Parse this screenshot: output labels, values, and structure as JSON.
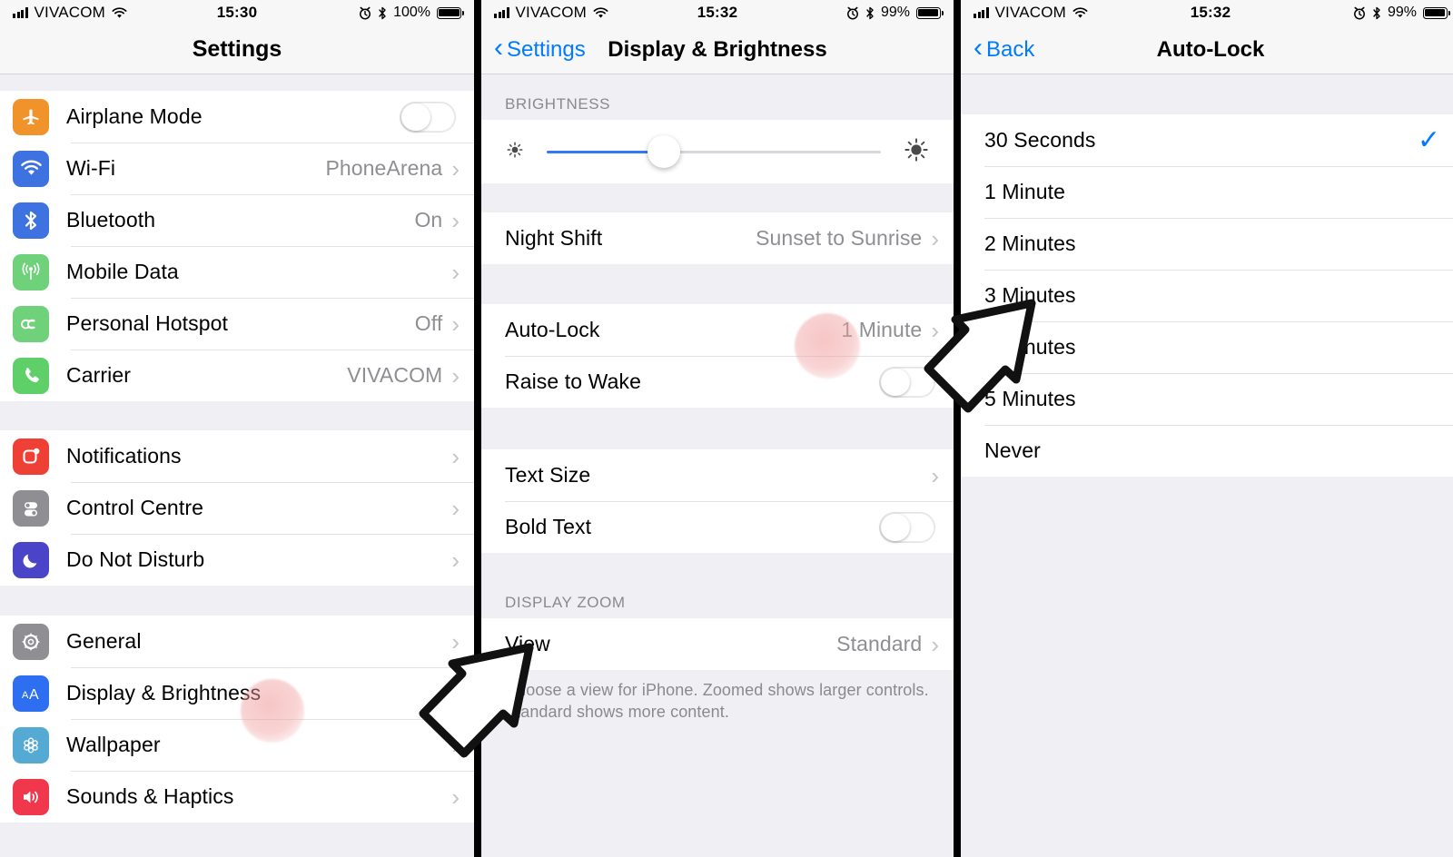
{
  "panels": [
    {
      "id": "settings",
      "status": {
        "carrier": "VIVACOM",
        "time": "15:30",
        "battery_pct": "100%"
      },
      "nav": {
        "title": "Settings",
        "back": ""
      },
      "groups": [
        {
          "rows": [
            {
              "label": "Airplane Mode",
              "icon": "airplane-icon",
              "color": "#f0932b",
              "control": "toggle-off"
            },
            {
              "label": "Wi-Fi",
              "icon": "wifi-icon",
              "color": "#3e72e0",
              "value": "PhoneArena",
              "control": "chevron"
            },
            {
              "label": "Bluetooth",
              "icon": "bluetooth-icon",
              "color": "#3e72e0",
              "value": "On",
              "control": "chevron"
            },
            {
              "label": "Mobile Data",
              "icon": "cellular-icon",
              "color": "#6fd27a",
              "value": "",
              "control": "chevron"
            },
            {
              "label": "Personal Hotspot",
              "icon": "hotspot-icon",
              "color": "#6fd27a",
              "value": "Off",
              "control": "chevron"
            },
            {
              "label": "Carrier",
              "icon": "phone-icon",
              "color": "#5fd068",
              "value": "VIVACOM",
              "control": "chevron"
            }
          ]
        },
        {
          "rows": [
            {
              "label": "Notifications",
              "icon": "notifications-icon",
              "color": "#ef4036",
              "value": "",
              "control": "chevron"
            },
            {
              "label": "Control Centre",
              "icon": "control-centre-icon",
              "color": "#8e8e93",
              "value": "",
              "control": "chevron"
            },
            {
              "label": "Do Not Disturb",
              "icon": "moon-icon",
              "color": "#4a44c9",
              "value": "",
              "control": "chevron"
            }
          ]
        },
        {
          "rows": [
            {
              "label": "General",
              "icon": "gear-icon",
              "color": "#8e8e93",
              "value": "",
              "control": "chevron"
            },
            {
              "label": "Display & Brightness",
              "icon": "text-size-icon",
              "color": "#2e6ff2",
              "value": "",
              "control": "chevron"
            },
            {
              "label": "Wallpaper",
              "icon": "wallpaper-icon",
              "color": "#55aad4",
              "value": "",
              "control": "chevron"
            },
            {
              "label": "Sounds & Haptics",
              "icon": "sound-icon",
              "color": "#f1374c",
              "value": "",
              "control": "chevron"
            }
          ]
        }
      ]
    },
    {
      "id": "display-brightness",
      "status": {
        "carrier": "VIVACOM",
        "time": "15:32",
        "battery_pct": "99%"
      },
      "nav": {
        "title": "Display & Brightness",
        "back": "Settings"
      },
      "section_brightness": "BRIGHTNESS",
      "brightness": {
        "value_percent": 35,
        "low_icon": "sun-low-icon",
        "high_icon": "sun-high-icon"
      },
      "rows_night": [
        {
          "label": "Night Shift",
          "value": "Sunset to Sunrise",
          "control": "chevron"
        }
      ],
      "rows_lock": [
        {
          "label": "Auto-Lock",
          "value": "1 Minute",
          "control": "chevron"
        },
        {
          "label": "Raise to Wake",
          "value": "",
          "control": "toggle-off"
        }
      ],
      "rows_text": [
        {
          "label": "Text Size",
          "value": "",
          "control": "chevron"
        },
        {
          "label": "Bold Text",
          "value": "",
          "control": "toggle-off"
        }
      ],
      "section_zoom": "DISPLAY ZOOM",
      "rows_zoom": [
        {
          "label": "View",
          "value": "Standard",
          "control": "chevron"
        }
      ],
      "footnote": "Choose a view for iPhone. Zoomed shows larger controls. Standard shows more content."
    },
    {
      "id": "auto-lock",
      "status": {
        "carrier": "VIVACOM",
        "time": "15:32",
        "battery_pct": "99%"
      },
      "nav": {
        "title": "Auto-Lock",
        "back": "Back"
      },
      "options": [
        {
          "label": "30 Seconds",
          "selected": true
        },
        {
          "label": "1 Minute",
          "selected": false
        },
        {
          "label": "2 Minutes",
          "selected": false
        },
        {
          "label": "3 Minutes",
          "selected": false
        },
        {
          "label": "4 Minutes",
          "selected": false
        },
        {
          "label": "5 Minutes",
          "selected": false
        },
        {
          "label": "Never",
          "selected": false
        }
      ]
    }
  ],
  "colors": {
    "accent_blue": "#007aff",
    "slider_blue": "#3478f6",
    "group_bg": "#efeff4",
    "secondary_text": "#8e8e93",
    "tap_highlight": "#f0a0a0"
  },
  "annotations": {
    "taps": [
      {
        "name": "tap-display-brightness"
      },
      {
        "name": "tap-auto-lock"
      }
    ],
    "arrows": [
      {
        "name": "arrow-to-display-brightness"
      },
      {
        "name": "arrow-to-auto-lock"
      }
    ]
  }
}
